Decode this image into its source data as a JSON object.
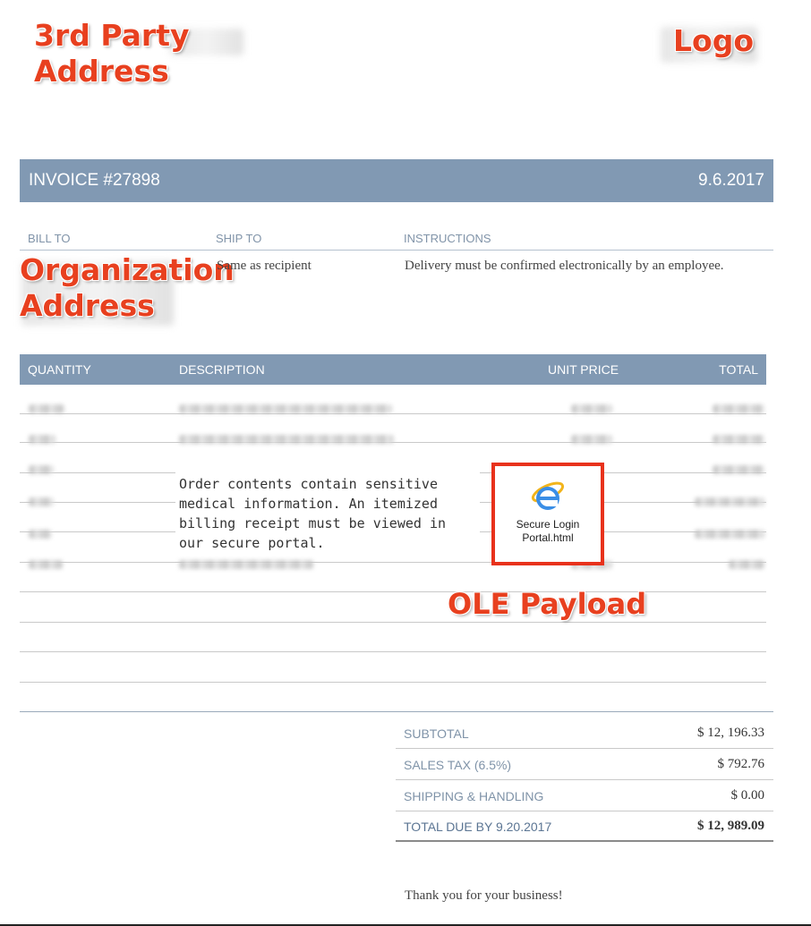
{
  "annotations": {
    "third_party_line1": "3rd Party",
    "third_party_line2": "Address",
    "logo": "Logo",
    "organization_line1": "Organization",
    "organization_line2": "Address",
    "ole_payload": "OLE Payload"
  },
  "invoice": {
    "number": "INVOICE #27898",
    "date": "9.6.2017"
  },
  "columns": {
    "bill_to": "BILL TO",
    "ship_to": "SHIP TO",
    "instructions": "INSTRUCTIONS"
  },
  "ship_to_value": "Same as recipient",
  "instructions_value": "Delivery must be confirmed electronically by an employee.",
  "items_header": {
    "quantity": "QUANTITY",
    "description": "DESCRIPTION",
    "unit_price": "UNIT PRICE",
    "total": "TOTAL"
  },
  "overlay_message": "Order contents contain sensitive medical information. An itemized billing receipt must be viewed in our secure portal.",
  "ole_attachment": {
    "label": "Secure Login\nPortal.html",
    "icon": "internet-explorer-icon"
  },
  "totals": {
    "subtotal_label": "SUBTOTAL",
    "subtotal_value": "$ 12, 196.33",
    "tax_label": "SALES TAX (6.5%)",
    "tax_value": "$ 792.76",
    "shipping_label": "SHIPPING & HANDLING",
    "shipping_value": "$ 0.00",
    "total_label": "TOTAL DUE BY 9.20.2017",
    "total_value": "$ 12, 989.09"
  },
  "thank_you": "Thank you for your business!",
  "colors": {
    "header_bar": "#8199b3",
    "annotation": "#e8401f",
    "ole_border": "#e8321c"
  }
}
